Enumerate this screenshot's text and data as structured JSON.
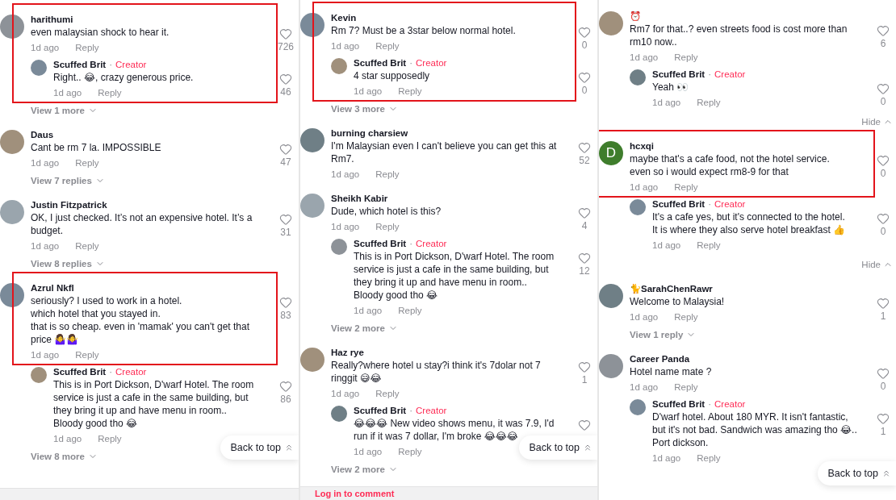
{
  "panels": [
    {
      "entries": [
        {
          "kind": "highlight",
          "entries": [
            {
              "kind": "comment",
              "avatar": {
                "kind": "photo"
              },
              "name": "harithumi",
              "text": "even malaysian shock to hear it.",
              "time": "1d ago",
              "reply": "Reply",
              "likes": "726"
            },
            {
              "kind": "reply",
              "avatar": {
                "kind": "photo"
              },
              "name": "Scuffed Brit",
              "separator": "·",
              "badge": "Creator",
              "text": "Right.. 😂, crazy generous price.",
              "time": "1d ago",
              "reply": "Reply",
              "likes": "46"
            }
          ]
        },
        {
          "kind": "more",
          "label": "View 1 more"
        },
        {
          "kind": "comment",
          "avatar": {
            "kind": "photo"
          },
          "name": "Daus",
          "text": "Cant be rm 7 la. IMPOSSIBLE",
          "time": "1d ago",
          "reply": "Reply",
          "likes": "47"
        },
        {
          "kind": "more",
          "label": "View 7 replies"
        },
        {
          "kind": "comment",
          "avatar": {
            "kind": "photo"
          },
          "name": "Justin Fitzpatrick",
          "text": "OK, I just checked. It’s not an expensive hotel. It’s a budget.",
          "time": "1d ago",
          "reply": "Reply",
          "likes": "31"
        },
        {
          "kind": "more",
          "label": "View 8 replies"
        },
        {
          "kind": "highlight",
          "entries": [
            {
              "kind": "comment",
              "avatar": {
                "kind": "photo"
              },
              "name": "Azrul Nkfl",
              "text": "seriously? I used to work in a hotel.\nwhich hotel that you stayed in.\nthat is so cheap. even in 'mamak' you can't get that price 🤷‍♀️🤷‍♀️",
              "time": "1d ago",
              "reply": "Reply",
              "likes": "83"
            }
          ]
        },
        {
          "kind": "reply",
          "avatar": {
            "kind": "photo"
          },
          "name": "Scuffed Brit",
          "separator": "·",
          "badge": "Creator",
          "text": "This is in Port Dickson, D'warf Hotel. The room service is just a cafe in the same building, but they bring it up and have menu in room..\nBloody good tho 😂",
          "time": "1d ago",
          "reply": "Reply",
          "likes": "86"
        },
        {
          "kind": "more",
          "label": "View 8 more"
        }
      ],
      "back_to_top": "Back to top",
      "footer": {
        "kind": "blank"
      }
    },
    {
      "entries": [
        {
          "kind": "highlight",
          "entries": [
            {
              "kind": "comment",
              "avatar": {
                "kind": "photo"
              },
              "name": "Kevin",
              "text": "Rm 7? Must be a 3star below normal hotel.",
              "time": "1d ago",
              "reply": "Reply",
              "likes": "0"
            },
            {
              "kind": "reply",
              "avatar": {
                "kind": "photo"
              },
              "name": "Scuffed Brit",
              "separator": "·",
              "badge": "Creator",
              "text": "4 star supposedly",
              "time": "1d ago",
              "reply": "Reply",
              "likes": "0"
            }
          ]
        },
        {
          "kind": "more",
          "label": "View 3 more"
        },
        {
          "kind": "comment",
          "avatar": {
            "kind": "photo"
          },
          "name": "burning charsiew",
          "text": "I'm Malaysian even I can't believe you can get this at Rm7.",
          "time": "1d ago",
          "reply": "Reply",
          "likes": "52"
        },
        {
          "kind": "comment",
          "avatar": {
            "kind": "photo"
          },
          "name": "Sheikh Kabir",
          "text": "Dude, which hotel is this?",
          "time": "1d ago",
          "reply": "Reply",
          "likes": "4"
        },
        {
          "kind": "reply",
          "avatar": {
            "kind": "photo"
          },
          "name": "Scuffed Brit",
          "separator": "·",
          "badge": "Creator",
          "text": "This is in Port Dickson, D'warf Hotel. The room service is just a cafe in the same building, but they bring it up and have menu in room..\nBloody good tho 😂",
          "time": "1d ago",
          "reply": "Reply",
          "likes": "12"
        },
        {
          "kind": "more",
          "label": "View 2 more"
        },
        {
          "kind": "comment",
          "avatar": {
            "kind": "photo"
          },
          "name": "Haz rye",
          "text": "Really?where hotel u stay?i think it's 7dolar not 7 ringgit 😅😂",
          "time": "1d ago",
          "reply": "Reply",
          "likes": "1"
        },
        {
          "kind": "reply",
          "avatar": {
            "kind": "photo"
          },
          "name": "Scuffed Brit",
          "separator": "·",
          "badge": "Creator",
          "text": "😂😂😂 New video shows menu, it was 7.9, I'd run if it was 7 dollar, I'm broke 😂😂😂",
          "time": "1d ago",
          "reply": "Reply"
        },
        {
          "kind": "more",
          "label": "View 2 more"
        }
      ],
      "back_to_top": "Back to top",
      "footer": {
        "kind": "login",
        "label": "Log in to comment"
      }
    },
    {
      "entries": [
        {
          "kind": "comment",
          "avatar": {
            "kind": "photo"
          },
          "name": "⏰",
          "text": "Rm7 for that..? even streets food is cost more than rm10 now..",
          "time": "1d ago",
          "reply": "Reply",
          "likes": "6"
        },
        {
          "kind": "reply",
          "avatar": {
            "kind": "photo"
          },
          "name": "Scuffed Brit",
          "separator": "·",
          "badge": "Creator",
          "text": "Yeah 👀",
          "time": "1d ago",
          "reply": "Reply",
          "likes": "0"
        },
        {
          "kind": "hide",
          "label": "Hide"
        },
        {
          "kind": "highlight",
          "entries": [
            {
              "kind": "comment",
              "avatar": {
                "kind": "letter",
                "letter": "D",
                "color": "#3f7d2c"
              },
              "name": "hcxqi",
              "text": "maybe that's a cafe food, not the hotel service.\neven so i would expect rm8-9 for that",
              "time": "1d ago",
              "reply": "Reply",
              "likes": "0"
            }
          ]
        },
        {
          "kind": "reply",
          "avatar": {
            "kind": "photo"
          },
          "name": "Scuffed Brit",
          "separator": "·",
          "badge": "Creator",
          "text": "It's a cafe yes, but it's connected to the hotel.\nIt is where they also serve hotel breakfast 👍",
          "time": "1d ago",
          "reply": "Reply",
          "likes": "0"
        },
        {
          "kind": "hide",
          "label": "Hide"
        },
        {
          "kind": "comment",
          "avatar": {
            "kind": "photo"
          },
          "name": "🐈SarahChenRawr",
          "text": "Welcome to Malaysia!",
          "time": "1d ago",
          "reply": "Reply",
          "likes": "1"
        },
        {
          "kind": "more",
          "label": "View 1 reply"
        },
        {
          "kind": "comment",
          "avatar": {
            "kind": "photo"
          },
          "name": "Career Panda",
          "text": "Hotel name mate ?",
          "time": "1d ago",
          "reply": "Reply",
          "likes": "0"
        },
        {
          "kind": "reply",
          "avatar": {
            "kind": "photo"
          },
          "name": "Scuffed Brit",
          "separator": "·",
          "badge": "Creator",
          "text": "D'warf hotel. About 180 MYR. It isn't fantastic, but it's not bad. Sandwich was amazing tho 😂.. Port dickson.",
          "time": "1d ago",
          "reply": "Reply",
          "likes": "1"
        }
      ],
      "back_to_top": "Back to top"
    }
  ]
}
